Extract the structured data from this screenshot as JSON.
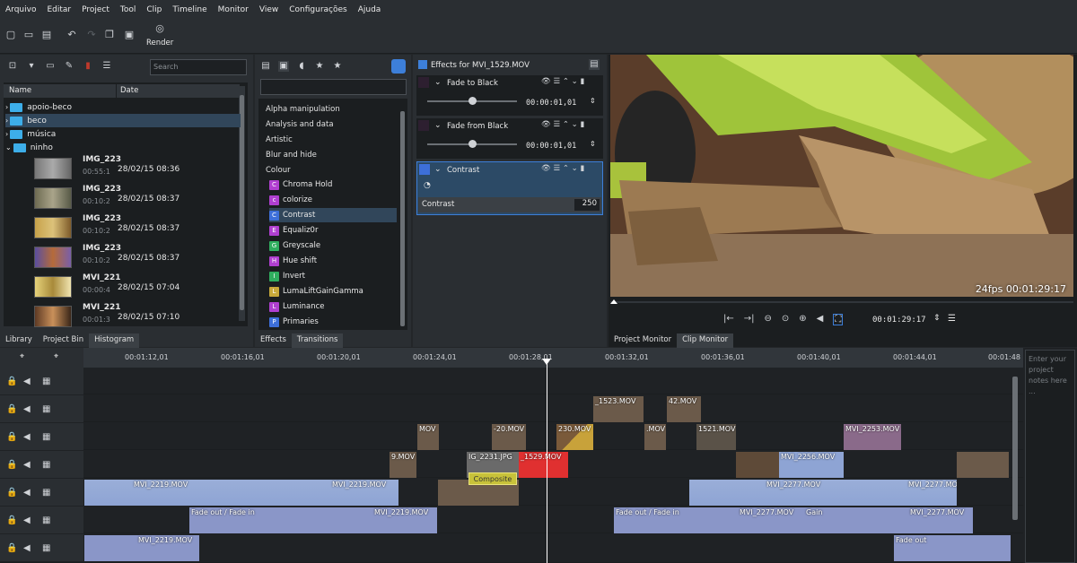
{
  "menu": [
    "Arquivo",
    "Editar",
    "Project",
    "Tool",
    "Clip",
    "Timeline",
    "Monitor",
    "View",
    "Configurações",
    "Ajuda"
  ],
  "toolbar": {
    "render_label": "Render"
  },
  "bin": {
    "search_placeholder": "Search",
    "col_name": "Name",
    "col_date": "Date",
    "folders": [
      "apoio-beco",
      "beco",
      "música",
      "ninho"
    ],
    "clips": [
      {
        "name": "IMG_223",
        "dur": "00:55:1",
        "date": "28/02/15 08:36"
      },
      {
        "name": "IMG_223",
        "dur": "00:10:2",
        "date": "28/02/15 08:37"
      },
      {
        "name": "IMG_223",
        "dur": "00:10:2",
        "date": "28/02/15 08:37"
      },
      {
        "name": "IMG_223",
        "dur": "00:10:2",
        "date": "28/02/15 08:37"
      },
      {
        "name": "MVI_221",
        "dur": "00:00:4",
        "date": "28/02/15 07:04"
      },
      {
        "name": "MVI_221",
        "dur": "00:01:3",
        "date": "28/02/15 07:10"
      }
    ],
    "tabs": [
      "Library",
      "Project Bin",
      "Histogram"
    ]
  },
  "effects": {
    "categories": [
      "Alpha manipulation",
      "Analysis and data",
      "Artistic",
      "Blur and hide",
      "Colour"
    ],
    "items": [
      {
        "label": "Chroma Hold",
        "color": "#b03fd0",
        "letter": "C"
      },
      {
        "label": "colorize",
        "color": "#b03fd0",
        "letter": "c"
      },
      {
        "label": "Contrast",
        "color": "#3d6fd9",
        "letter": "C"
      },
      {
        "label": "Equaliz0r",
        "color": "#b03fd0",
        "letter": "E"
      },
      {
        "label": "Greyscale",
        "color": "#2fae5e",
        "letter": "G"
      },
      {
        "label": "Hue shift",
        "color": "#b03fd0",
        "letter": "H"
      },
      {
        "label": "Invert",
        "color": "#2fae5e",
        "letter": "I"
      },
      {
        "label": "LumaLiftGainGamma",
        "color": "#c8a93a",
        "letter": "L"
      },
      {
        "label": "Luminance",
        "color": "#b03fd0",
        "letter": "L"
      },
      {
        "label": "Primaries",
        "color": "#3d6fd9",
        "letter": "P"
      }
    ],
    "tabs": [
      "Effects",
      "Transitions"
    ]
  },
  "stack": {
    "title": "Effects for MVI_1529.MOV",
    "effects": [
      {
        "name": "Fade to Black",
        "time": "00:00:01,01",
        "color": "#2d1f30"
      },
      {
        "name": "Fade from Black",
        "time": "00:00:01,01",
        "color": "#2d1f30"
      },
      {
        "name": "Contrast",
        "param": "Contrast",
        "value": "250",
        "color": "#3d6fd9"
      }
    ]
  },
  "monitor": {
    "overlay": "24fps 00:01:29:17",
    "timecode": "00:01:29:17",
    "tabs": [
      "Project Monitor",
      "Clip Monitor"
    ]
  },
  "timeline": {
    "ticks": [
      "00:01:12,01",
      "00:01:16,01",
      "00:01:20,01",
      "00:01:24,01",
      "00:01:28,01",
      "00:01:32,01",
      "00:01:36,01",
      "00:01:40,01",
      "00:01:44,01",
      "00:01:48"
    ],
    "notes_placeholder": "Enter your project notes here ...",
    "clips": {
      "c1": "_1523.MOV",
      "c2": "42.MOV",
      "c3": "MOV",
      "c4": "-20.MOV",
      "c5": "230.MOV",
      "c6": ".MOV",
      "c7": "1521.MOV",
      "c8": "MVI_2253.MOV",
      "c9": "9.MOV",
      "c10": "IG_2231.JPG",
      "c11": "_1529.MOV",
      "c12": "MVI_2256.MOV",
      "c13": "MVI_2219.MOV",
      "c14": "MVI_2219.MOV",
      "c15": "Composite",
      "c16": "MVI_2277.MOV",
      "c17": "MVI_2277.MOV",
      "c18": "Fade out / Fade in",
      "c19": "MVI_2219.MOV",
      "c20": "Fade out / Fade in",
      "c21": "MVI_2277.MOV",
      "c22": "Gain",
      "c23": "MVI_2277.MOV",
      "c24": "MVI_2219.MOV",
      "c25": "Fade out"
    }
  }
}
